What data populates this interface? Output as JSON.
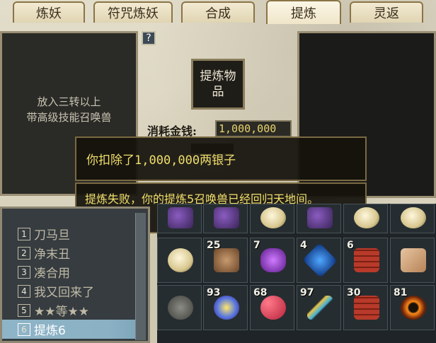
{
  "tabs": [
    {
      "label": "炼妖"
    },
    {
      "label": "符咒炼妖"
    },
    {
      "label": "合成"
    },
    {
      "label": "提炼",
      "active": true
    },
    {
      "label": "灵返"
    }
  ],
  "left_panel": {
    "hint_line1": "放入三转以上",
    "hint_line2": "带高级技能召唤兽"
  },
  "help_button": {
    "label": "?"
  },
  "refine_button": {
    "label": "提炼物品"
  },
  "cost": {
    "label": "消耗金钱:",
    "value": "1,000,000"
  },
  "messages": [
    {
      "text": "你扣除了1,000,000两银子"
    },
    {
      "text": "提炼失败，你的提炼5召唤兽已经回归天地间。"
    }
  ],
  "pet_list": [
    {
      "num": "1",
      "name": "刀马旦"
    },
    {
      "num": "2",
      "name": "净末丑"
    },
    {
      "num": "3",
      "name": "凑合用"
    },
    {
      "num": "4",
      "name": "我又回来了"
    },
    {
      "num": "5",
      "name": "★★等★★"
    },
    {
      "num": "6",
      "name": "提炼6",
      "selected": true
    }
  ],
  "inventory": {
    "row1": [
      {
        "icon": "purple-feather-icon",
        "count": ""
      },
      {
        "icon": "purple-feather-icon",
        "count": ""
      },
      {
        "icon": "lantern-icon",
        "count": ""
      },
      {
        "icon": "purple-feather-icon",
        "count": ""
      },
      {
        "icon": "lantern-icon",
        "count": ""
      },
      {
        "icon": "lantern-icon",
        "count": ""
      }
    ],
    "row2": [
      {
        "icon": "lantern-icon",
        "count": ""
      },
      {
        "icon": "brown-hide-icon",
        "count": "25"
      },
      {
        "icon": "purple-crystal-icon",
        "count": "7"
      },
      {
        "icon": "blue-gem-icon",
        "count": "4"
      },
      {
        "icon": "red-brick-icon",
        "count": "6"
      },
      {
        "icon": "paper-scroll-icon",
        "count": ""
      }
    ],
    "row3": [
      {
        "icon": "stone-pile-icon",
        "count": ""
      },
      {
        "icon": "magic-orb-icon",
        "count": "93"
      },
      {
        "icon": "red-beads-icon",
        "count": "68"
      },
      {
        "icon": "golden-feather-icon",
        "count": "97"
      },
      {
        "icon": "red-brick-icon",
        "count": "30"
      },
      {
        "icon": "fire-ring-icon",
        "count": "81"
      }
    ]
  },
  "colors": {
    "accent_text": "#f2df6c",
    "selected_row": "#8fb4c8"
  }
}
